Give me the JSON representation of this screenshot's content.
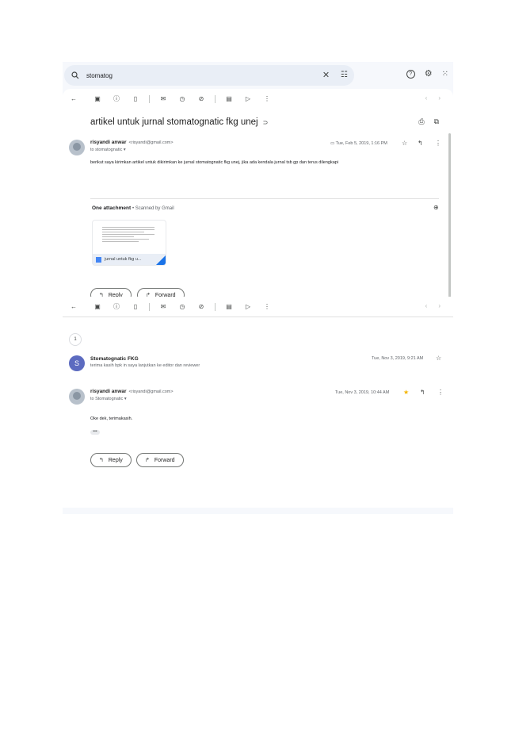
{
  "search": {
    "query": "stomatog"
  },
  "toolbar_icons": [
    "back-arrow-icon",
    "archive-icon",
    "report-spam-icon",
    "delete-icon",
    "mark-unread-icon",
    "snooze-icon",
    "add-task-icon",
    "move-to-icon",
    "label-icon",
    "more-icon"
  ],
  "thread1": {
    "subject": "artikel untuk jurnal stomatognatic fkg unej",
    "sender_name": "risyandi anwar",
    "sender_email": "<risyandi@gmail.com>",
    "to_line": "to stomatognatic",
    "date": "Tue, Feb 5, 2019, 1:16 PM",
    "body": "berikut saya kirimkan artikel untuk dikirimkan ke jurnal stomatognatic fkg unej, jika ada kendala jurnal tsb gp dan terus dilengkapi",
    "attachment_header": "One attachment",
    "attachment_scan": "• Scanned by Gmail",
    "attachment_name": "jurnal untuk fkg u...",
    "reply_label": "Reply",
    "forward_label": "Forward"
  },
  "thread2": {
    "collapsed_count": "1",
    "msg1": {
      "avatar_letter": "S",
      "sender": "Stomatognatic FKG",
      "snippet": "terima kasih bpk in saya lanjutkan ke editor dan reviewer",
      "date": "Tue, Nov 3, 2019, 9:21 AM"
    },
    "msg2": {
      "sender_name": "risyandi anwar",
      "sender_email": "<risyandi@gmail.com>",
      "to_line": "to Stomatognatic",
      "date": "Tue, Nov 3, 2019, 10:44 AM",
      "body": "Oke dek, terimakasih.",
      "dots": "•••"
    },
    "reply_label": "Reply",
    "forward_label": "Forward"
  },
  "colors": {
    "frame_bg": "#f6f8fc",
    "search_bg": "#e9eef6",
    "avatar_s": "#5c6bc0",
    "star": "#f4b400"
  }
}
